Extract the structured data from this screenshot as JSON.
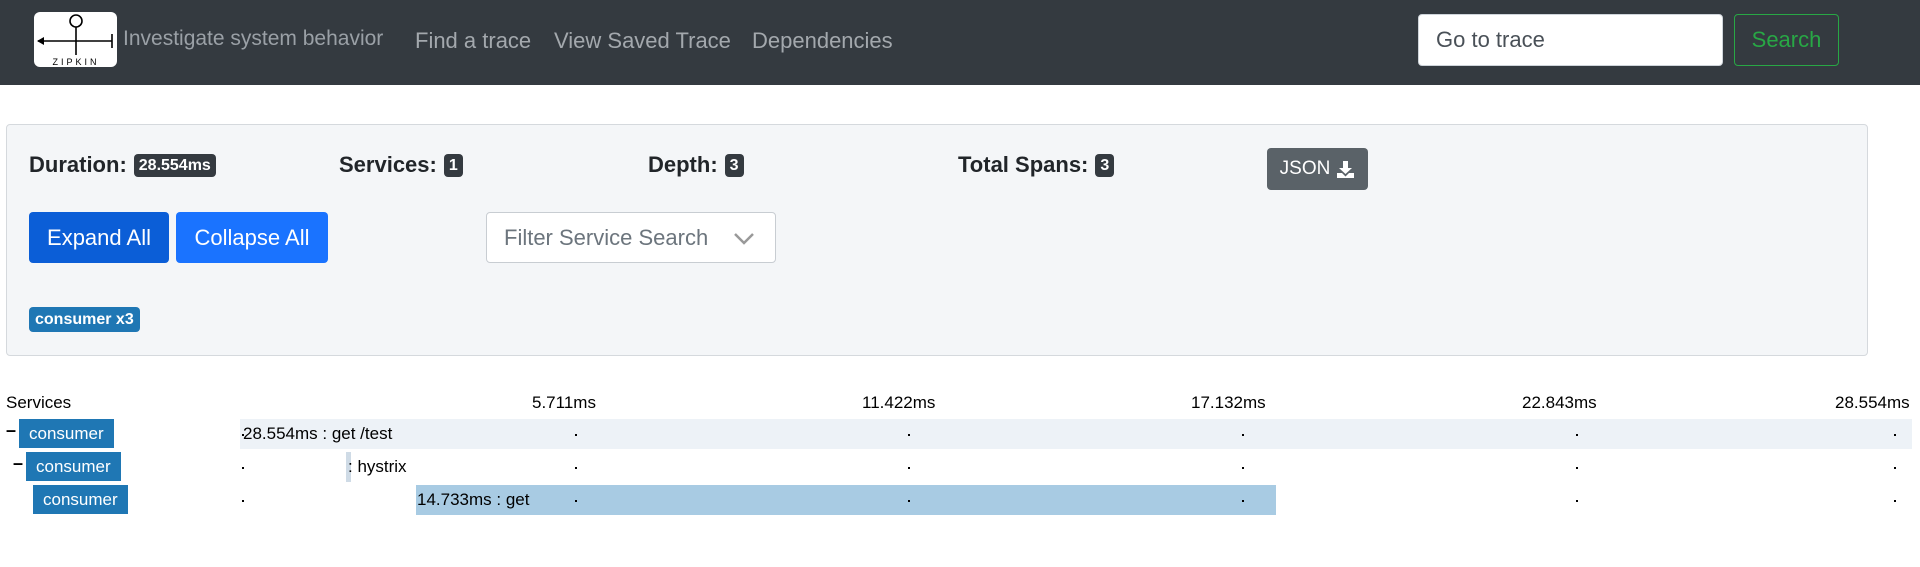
{
  "navbar": {
    "logo_text": "ZIPKIN",
    "brand_tagline": "Investigate system behavior",
    "links": [
      "Find a trace",
      "View Saved Trace",
      "Dependencies"
    ],
    "goto_placeholder": "Go to trace",
    "search_label": "Search"
  },
  "summary": {
    "duration_label": "Duration:",
    "duration_value": "28.554ms",
    "services_label": "Services:",
    "services_value": "1",
    "depth_label": "Depth:",
    "depth_value": "3",
    "total_spans_label": "Total Spans:",
    "total_spans_value": "3",
    "json_label": "JSON",
    "json_icon": "download-icon",
    "expand_all_label": "Expand All",
    "collapse_all_label": "Collapse All",
    "filter_placeholder": "Filter Service Search",
    "service_badge": "consumer x3"
  },
  "timeline": {
    "services_header": "Services",
    "ticks": [
      "5.711ms",
      "11.422ms",
      "17.132ms",
      "22.843ms",
      "28.554ms"
    ],
    "rows": [
      {
        "toggle": "–",
        "service": "consumer",
        "span_text": "28.554ms : get /test",
        "start_ms": 0,
        "duration_ms": 28.554
      },
      {
        "toggle": "–",
        "service": "consumer",
        "span_text": ": hystrix",
        "start_ms": 1.8,
        "duration_ms": 0.08
      },
      {
        "toggle": "",
        "service": "consumer",
        "span_text": "14.733ms : get",
        "start_ms": 3.0,
        "duration_ms": 14.733
      }
    ]
  },
  "colors": {
    "navbar_bg": "#343a40",
    "service_blue": "#1f77b4",
    "span_bar": "#a8cbe3",
    "success_green": "#28a745",
    "primary_blue": "#0b5ed7"
  }
}
